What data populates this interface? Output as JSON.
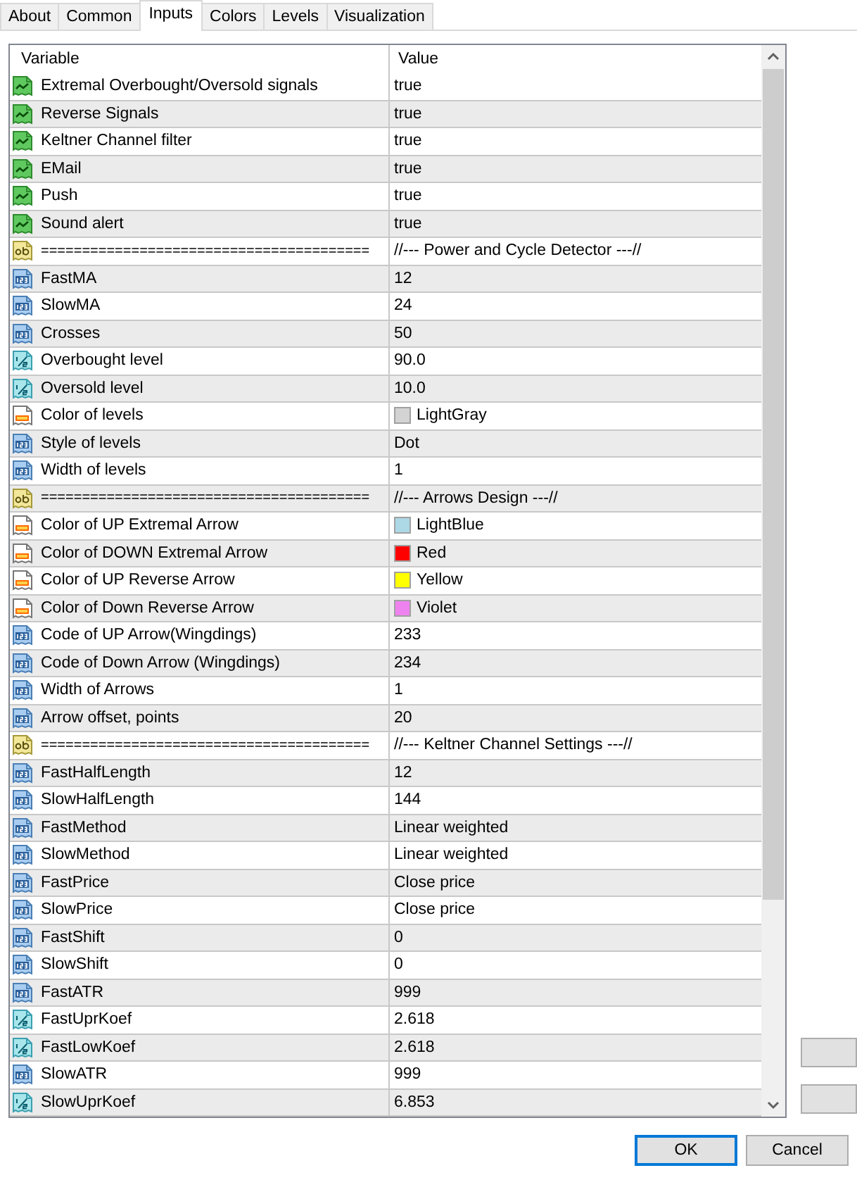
{
  "tabs": [
    {
      "label": "About",
      "selected": false
    },
    {
      "label": "Common",
      "selected": false
    },
    {
      "label": "Inputs",
      "selected": true
    },
    {
      "label": "Colors",
      "selected": false
    },
    {
      "label": "Levels",
      "selected": false
    },
    {
      "label": "Visualization",
      "selected": false
    }
  ],
  "table": {
    "columns": [
      "Variable",
      "Value"
    ],
    "rows": [
      {
        "kind": "bool",
        "variable": "Extremal Overbought/Oversold signals",
        "value": "true"
      },
      {
        "kind": "bool",
        "variable": "Reverse Signals",
        "value": "true"
      },
      {
        "kind": "bool",
        "variable": "Keltner Channel filter",
        "value": "true"
      },
      {
        "kind": "bool",
        "variable": "EMail",
        "value": "true"
      },
      {
        "kind": "bool",
        "variable": "Push",
        "value": "true"
      },
      {
        "kind": "bool",
        "variable": "Sound alert",
        "value": "true"
      },
      {
        "kind": "string",
        "variable": "========================================",
        "value": "//--- Power and Cycle Detector ---//"
      },
      {
        "kind": "int",
        "variable": "FastMA",
        "value": "12"
      },
      {
        "kind": "int",
        "variable": "SlowMA",
        "value": "24"
      },
      {
        "kind": "int",
        "variable": "Crosses",
        "value": "50"
      },
      {
        "kind": "double",
        "variable": "Overbought level",
        "value": "90.0"
      },
      {
        "kind": "double",
        "variable": "Oversold level",
        "value": "10.0"
      },
      {
        "kind": "color",
        "variable": "Color of levels",
        "value": "LightGray",
        "color": "#d3d3d3"
      },
      {
        "kind": "int",
        "variable": "Style of levels",
        "value": "Dot"
      },
      {
        "kind": "int",
        "variable": "Width of levels",
        "value": "1"
      },
      {
        "kind": "string",
        "variable": "========================================",
        "value": "//--- Arrows Design ---//"
      },
      {
        "kind": "color",
        "variable": "Color of UP Extremal Arrow",
        "value": "LightBlue",
        "color": "#add8e6"
      },
      {
        "kind": "color",
        "variable": "Color of DOWN Extremal Arrow",
        "value": "Red",
        "color": "#ff0000"
      },
      {
        "kind": "color",
        "variable": "Color of UP Reverse Arrow",
        "value": "Yellow",
        "color": "#ffff00"
      },
      {
        "kind": "color",
        "variable": "Color of Down Reverse Arrow",
        "value": "Violet",
        "color": "#ee82ee"
      },
      {
        "kind": "int",
        "variable": "Code of UP Arrow(Wingdings)",
        "value": "233"
      },
      {
        "kind": "int",
        "variable": "Code of Down Arrow (Wingdings)",
        "value": "234"
      },
      {
        "kind": "int",
        "variable": "Width of Arrows",
        "value": "1"
      },
      {
        "kind": "int",
        "variable": "Arrow offset, points",
        "value": "20"
      },
      {
        "kind": "string",
        "variable": "========================================",
        "value": "//--- Keltner Channel Settings ---//"
      },
      {
        "kind": "int",
        "variable": "FastHalfLength",
        "value": "12"
      },
      {
        "kind": "int",
        "variable": "SlowHalfLength",
        "value": "144"
      },
      {
        "kind": "int",
        "variable": "FastMethod",
        "value": "Linear weighted"
      },
      {
        "kind": "int",
        "variable": "SlowMethod",
        "value": "Linear weighted"
      },
      {
        "kind": "int",
        "variable": "FastPrice",
        "value": "Close price"
      },
      {
        "kind": "int",
        "variable": "SlowPrice",
        "value": "Close price"
      },
      {
        "kind": "int",
        "variable": "FastShift",
        "value": "0"
      },
      {
        "kind": "int",
        "variable": "SlowShift",
        "value": "0"
      },
      {
        "kind": "int",
        "variable": "FastATR",
        "value": "999"
      },
      {
        "kind": "double",
        "variable": "FastUprKoef",
        "value": "2.618"
      },
      {
        "kind": "double",
        "variable": "FastLowKoef",
        "value": "2.618"
      },
      {
        "kind": "int",
        "variable": "SlowATR",
        "value": "999"
      },
      {
        "kind": "double",
        "variable": "SlowUprKoef",
        "value": "6.853"
      }
    ]
  },
  "buttons": [
    {
      "label": "OK",
      "default": true
    },
    {
      "label": "Cancel",
      "default": false
    }
  ]
}
